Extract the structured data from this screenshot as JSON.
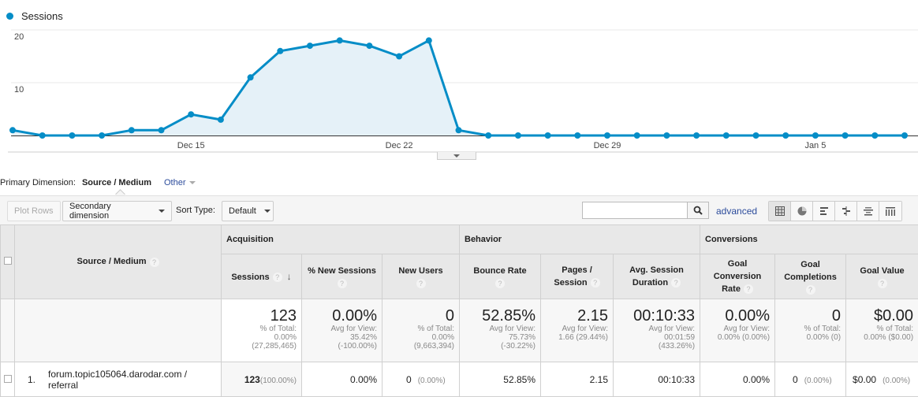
{
  "legend": {
    "label": "Sessions",
    "color": "#058dc7"
  },
  "chart_data": {
    "type": "area",
    "title": "",
    "series": [
      {
        "name": "Sessions",
        "color": "#058dc7",
        "values": [
          1,
          0,
          0,
          0,
          1,
          1,
          4,
          3,
          11,
          16,
          17,
          18,
          17,
          15,
          18,
          1,
          0,
          0,
          0,
          0,
          0,
          0,
          0,
          0,
          0,
          0,
          0,
          0,
          0,
          0,
          0
        ]
      }
    ],
    "x": [
      "Dec 9",
      "Dec 10",
      "Dec 11",
      "Dec 12",
      "Dec 13",
      "Dec 14",
      "Dec 15",
      "Dec 16",
      "Dec 17",
      "Dec 18",
      "Dec 19",
      "Dec 20",
      "Dec 21",
      "Dec 22",
      "Dec 23",
      "Dec 24",
      "Dec 25",
      "Dec 26",
      "Dec 27",
      "Dec 28",
      "Dec 29",
      "Dec 30",
      "Dec 31",
      "Jan 1",
      "Jan 2",
      "Jan 3",
      "Jan 4",
      "Jan 5",
      "Jan 6",
      "Jan 7",
      "Jan 8"
    ],
    "x_tick_labels": [
      "Dec 15",
      "Dec 22",
      "Dec 29",
      "Jan 5"
    ],
    "x_tick_indices": [
      6,
      13,
      20,
      27
    ],
    "y_tick_labels": [
      "10",
      "20"
    ],
    "y_ticks": [
      10,
      20
    ],
    "ylim": [
      0,
      20
    ],
    "grid": true,
    "legend": "top-left"
  },
  "primary_dimension": {
    "label": "Primary Dimension:",
    "current": "Source / Medium",
    "other": "Other"
  },
  "toolbar": {
    "plot_rows": "Plot Rows",
    "secondary_dimension": "Secondary dimension",
    "sort_type_label": "Sort Type:",
    "sort_type_value": "Default",
    "search_placeholder": "",
    "advanced": "advanced",
    "views": [
      "table-view",
      "pie-view",
      "performance-view",
      "comparison-view",
      "term-cloud-view",
      "pivot-view"
    ]
  },
  "table": {
    "dimension_header": "Source / Medium",
    "groups": [
      "Acquisition",
      "Behavior",
      "Conversions"
    ],
    "columns": [
      "Sessions",
      "% New Sessions",
      "New Users",
      "Bounce Rate",
      "Pages / Session",
      "Avg. Session Duration",
      "Goal Conversion Rate",
      "Goal Completions",
      "Goal Value"
    ],
    "totals": [
      {
        "value": "123",
        "sub1": "% of Total:",
        "sub2": "0.00%",
        "sub3": "(27,285,465)"
      },
      {
        "value": "0.00%",
        "sub1": "Avg for View:",
        "sub2": "35.42%",
        "sub3": "(-100.00%)"
      },
      {
        "value": "0",
        "sub1": "% of Total:",
        "sub2": "0.00%",
        "sub3": "(9,663,394)"
      },
      {
        "value": "52.85%",
        "sub1": "Avg for View:",
        "sub2": "75.73%",
        "sub3": "(-30.22%)"
      },
      {
        "value": "2.15",
        "sub1": "Avg for View:",
        "sub2": "1.66 (29.44%)",
        "sub3": ""
      },
      {
        "value": "00:10:33",
        "sub1": "Avg for View:",
        "sub2": "00:01:59",
        "sub3": "(433.26%)"
      },
      {
        "value": "0.00%",
        "sub1": "Avg for View:",
        "sub2": "0.00% (0.00%)",
        "sub3": ""
      },
      {
        "value": "0",
        "sub1": "% of Total:",
        "sub2": "0.00% (0)",
        "sub3": ""
      },
      {
        "value": "$0.00",
        "sub1": "% of Total:",
        "sub2": "0.00% ($0.00)",
        "sub3": ""
      }
    ],
    "rows": [
      {
        "index": "1.",
        "source": "forum.topic105064.darodar.com / referral",
        "sessions": "123",
        "sessions_pct": "(100.00%)",
        "new_sessions": "0.00%",
        "new_users": "0",
        "new_users_pct": "(0.00%)",
        "bounce_rate": "52.85%",
        "pages_session": "2.15",
        "avg_duration": "00:10:33",
        "goal_conv_rate": "0.00%",
        "goal_completions": "0",
        "goal_completions_pct": "(0.00%)",
        "goal_value": "$0.00",
        "goal_value_pct": "(0.00%)"
      }
    ]
  }
}
